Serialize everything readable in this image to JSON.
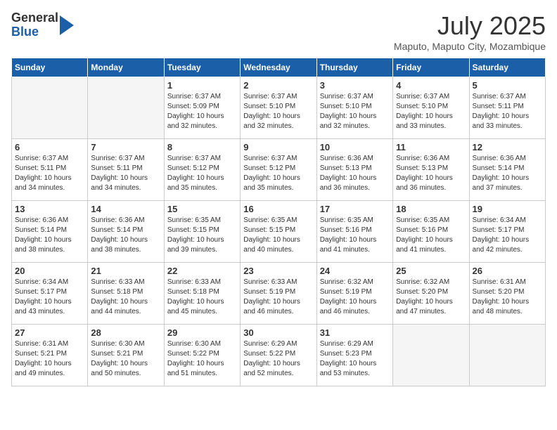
{
  "logo": {
    "general": "General",
    "blue": "Blue"
  },
  "title": "July 2025",
  "subtitle": "Maputo, Maputo City, Mozambique",
  "days_of_week": [
    "Sunday",
    "Monday",
    "Tuesday",
    "Wednesday",
    "Thursday",
    "Friday",
    "Saturday"
  ],
  "weeks": [
    [
      {
        "day": "",
        "info": ""
      },
      {
        "day": "",
        "info": ""
      },
      {
        "day": "1",
        "info": "Sunrise: 6:37 AM\nSunset: 5:09 PM\nDaylight: 10 hours and 32 minutes."
      },
      {
        "day": "2",
        "info": "Sunrise: 6:37 AM\nSunset: 5:10 PM\nDaylight: 10 hours and 32 minutes."
      },
      {
        "day": "3",
        "info": "Sunrise: 6:37 AM\nSunset: 5:10 PM\nDaylight: 10 hours and 32 minutes."
      },
      {
        "day": "4",
        "info": "Sunrise: 6:37 AM\nSunset: 5:10 PM\nDaylight: 10 hours and 33 minutes."
      },
      {
        "day": "5",
        "info": "Sunrise: 6:37 AM\nSunset: 5:11 PM\nDaylight: 10 hours and 33 minutes."
      }
    ],
    [
      {
        "day": "6",
        "info": "Sunrise: 6:37 AM\nSunset: 5:11 PM\nDaylight: 10 hours and 34 minutes."
      },
      {
        "day": "7",
        "info": "Sunrise: 6:37 AM\nSunset: 5:11 PM\nDaylight: 10 hours and 34 minutes."
      },
      {
        "day": "8",
        "info": "Sunrise: 6:37 AM\nSunset: 5:12 PM\nDaylight: 10 hours and 35 minutes."
      },
      {
        "day": "9",
        "info": "Sunrise: 6:37 AM\nSunset: 5:12 PM\nDaylight: 10 hours and 35 minutes."
      },
      {
        "day": "10",
        "info": "Sunrise: 6:36 AM\nSunset: 5:13 PM\nDaylight: 10 hours and 36 minutes."
      },
      {
        "day": "11",
        "info": "Sunrise: 6:36 AM\nSunset: 5:13 PM\nDaylight: 10 hours and 36 minutes."
      },
      {
        "day": "12",
        "info": "Sunrise: 6:36 AM\nSunset: 5:14 PM\nDaylight: 10 hours and 37 minutes."
      }
    ],
    [
      {
        "day": "13",
        "info": "Sunrise: 6:36 AM\nSunset: 5:14 PM\nDaylight: 10 hours and 38 minutes."
      },
      {
        "day": "14",
        "info": "Sunrise: 6:36 AM\nSunset: 5:14 PM\nDaylight: 10 hours and 38 minutes."
      },
      {
        "day": "15",
        "info": "Sunrise: 6:35 AM\nSunset: 5:15 PM\nDaylight: 10 hours and 39 minutes."
      },
      {
        "day": "16",
        "info": "Sunrise: 6:35 AM\nSunset: 5:15 PM\nDaylight: 10 hours and 40 minutes."
      },
      {
        "day": "17",
        "info": "Sunrise: 6:35 AM\nSunset: 5:16 PM\nDaylight: 10 hours and 41 minutes."
      },
      {
        "day": "18",
        "info": "Sunrise: 6:35 AM\nSunset: 5:16 PM\nDaylight: 10 hours and 41 minutes."
      },
      {
        "day": "19",
        "info": "Sunrise: 6:34 AM\nSunset: 5:17 PM\nDaylight: 10 hours and 42 minutes."
      }
    ],
    [
      {
        "day": "20",
        "info": "Sunrise: 6:34 AM\nSunset: 5:17 PM\nDaylight: 10 hours and 43 minutes."
      },
      {
        "day": "21",
        "info": "Sunrise: 6:33 AM\nSunset: 5:18 PM\nDaylight: 10 hours and 44 minutes."
      },
      {
        "day": "22",
        "info": "Sunrise: 6:33 AM\nSunset: 5:18 PM\nDaylight: 10 hours and 45 minutes."
      },
      {
        "day": "23",
        "info": "Sunrise: 6:33 AM\nSunset: 5:19 PM\nDaylight: 10 hours and 46 minutes."
      },
      {
        "day": "24",
        "info": "Sunrise: 6:32 AM\nSunset: 5:19 PM\nDaylight: 10 hours and 46 minutes."
      },
      {
        "day": "25",
        "info": "Sunrise: 6:32 AM\nSunset: 5:20 PM\nDaylight: 10 hours and 47 minutes."
      },
      {
        "day": "26",
        "info": "Sunrise: 6:31 AM\nSunset: 5:20 PM\nDaylight: 10 hours and 48 minutes."
      }
    ],
    [
      {
        "day": "27",
        "info": "Sunrise: 6:31 AM\nSunset: 5:21 PM\nDaylight: 10 hours and 49 minutes."
      },
      {
        "day": "28",
        "info": "Sunrise: 6:30 AM\nSunset: 5:21 PM\nDaylight: 10 hours and 50 minutes."
      },
      {
        "day": "29",
        "info": "Sunrise: 6:30 AM\nSunset: 5:22 PM\nDaylight: 10 hours and 51 minutes."
      },
      {
        "day": "30",
        "info": "Sunrise: 6:29 AM\nSunset: 5:22 PM\nDaylight: 10 hours and 52 minutes."
      },
      {
        "day": "31",
        "info": "Sunrise: 6:29 AM\nSunset: 5:23 PM\nDaylight: 10 hours and 53 minutes."
      },
      {
        "day": "",
        "info": ""
      },
      {
        "day": "",
        "info": ""
      }
    ]
  ]
}
